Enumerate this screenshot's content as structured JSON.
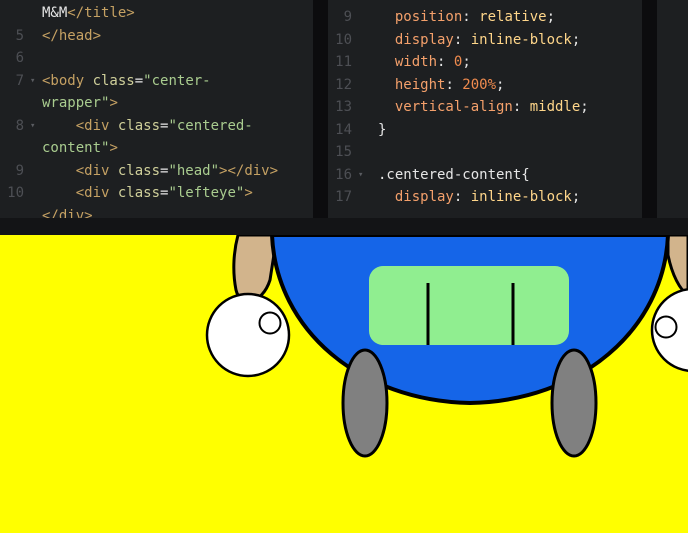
{
  "html_pane": {
    "lines": [
      {
        "num": "",
        "fold": false,
        "segments": [
          {
            "t": "M&M",
            "c": "c-text"
          },
          {
            "t": "</title>",
            "c": "c-tag"
          }
        ]
      },
      {
        "num": "5",
        "fold": false,
        "segments": [
          {
            "t": "</head>",
            "c": "c-tag"
          }
        ]
      },
      {
        "num": "6",
        "fold": false,
        "segments": []
      },
      {
        "num": "7",
        "fold": true,
        "segments": [
          {
            "t": "<body ",
            "c": "c-tag"
          },
          {
            "t": "class",
            "c": "c-attr"
          },
          {
            "t": "=",
            "c": "c-text"
          },
          {
            "t": "\"center-",
            "c": "c-str"
          }
        ]
      },
      {
        "num": "",
        "fold": false,
        "segments": [
          {
            "t": "wrapper\"",
            "c": "c-str"
          },
          {
            "t": ">",
            "c": "c-tag"
          }
        ]
      },
      {
        "num": "8",
        "fold": true,
        "segments": [
          {
            "t": "    <div ",
            "c": "c-tag"
          },
          {
            "t": "class",
            "c": "c-attr"
          },
          {
            "t": "=",
            "c": "c-text"
          },
          {
            "t": "\"centered-",
            "c": "c-str"
          }
        ]
      },
      {
        "num": "",
        "fold": false,
        "segments": [
          {
            "t": "content\"",
            "c": "c-str"
          },
          {
            "t": ">",
            "c": "c-tag"
          }
        ]
      },
      {
        "num": "9",
        "fold": false,
        "segments": [
          {
            "t": "    <div ",
            "c": "c-tag"
          },
          {
            "t": "class",
            "c": "c-attr"
          },
          {
            "t": "=",
            "c": "c-text"
          },
          {
            "t": "\"head\"",
            "c": "c-str"
          },
          {
            "t": "></div>",
            "c": "c-tag"
          }
        ]
      },
      {
        "num": "10",
        "fold": false,
        "segments": [
          {
            "t": "    <div ",
            "c": "c-tag"
          },
          {
            "t": "class",
            "c": "c-attr"
          },
          {
            "t": "=",
            "c": "c-text"
          },
          {
            "t": "\"lefteye\"",
            "c": "c-str"
          },
          {
            "t": ">",
            "c": "c-tag"
          }
        ]
      },
      {
        "num": "",
        "fold": false,
        "segments": [
          {
            "t": "</div>",
            "c": "c-tag"
          }
        ]
      }
    ]
  },
  "css_pane": {
    "lines": [
      {
        "num": "9",
        "fold": false,
        "segments": [
          {
            "t": "  position",
            "c": "c-prop"
          },
          {
            "t": ": ",
            "c": "c-text"
          },
          {
            "t": "relative",
            "c": "c-val"
          },
          {
            "t": ";",
            "c": "c-text"
          }
        ]
      },
      {
        "num": "10",
        "fold": false,
        "segments": [
          {
            "t": "  display",
            "c": "c-prop"
          },
          {
            "t": ": ",
            "c": "c-text"
          },
          {
            "t": "inline-block",
            "c": "c-val"
          },
          {
            "t": ";",
            "c": "c-text"
          }
        ]
      },
      {
        "num": "11",
        "fold": false,
        "segments": [
          {
            "t": "  width",
            "c": "c-prop"
          },
          {
            "t": ": ",
            "c": "c-text"
          },
          {
            "t": "0",
            "c": "c-num"
          },
          {
            "t": ";",
            "c": "c-text"
          }
        ]
      },
      {
        "num": "12",
        "fold": false,
        "segments": [
          {
            "t": "  height",
            "c": "c-prop"
          },
          {
            "t": ": ",
            "c": "c-text"
          },
          {
            "t": "200%",
            "c": "c-num"
          },
          {
            "t": ";",
            "c": "c-text"
          }
        ]
      },
      {
        "num": "13",
        "fold": false,
        "segments": [
          {
            "t": "  vertical-align",
            "c": "c-prop"
          },
          {
            "t": ": ",
            "c": "c-text"
          },
          {
            "t": "middle",
            "c": "c-val"
          },
          {
            "t": ";",
            "c": "c-text"
          }
        ]
      },
      {
        "num": "14",
        "fold": false,
        "segments": [
          {
            "t": "}",
            "c": "c-text"
          }
        ]
      },
      {
        "num": "15",
        "fold": false,
        "segments": []
      },
      {
        "num": "16",
        "fold": true,
        "segments": [
          {
            "t": ".centered-content{",
            "c": "c-sel"
          }
        ]
      },
      {
        "num": "17",
        "fold": false,
        "segments": [
          {
            "t": "  display",
            "c": "c-prop"
          },
          {
            "t": ": ",
            "c": "c-text"
          },
          {
            "t": "inline-block",
            "c": "c-val"
          },
          {
            "t": ";",
            "c": "c-text"
          }
        ]
      }
    ]
  },
  "preview": {
    "background": "#ffff00",
    "body_color": "#1565e8",
    "visor_color": "#90ee90",
    "foot_color": "#808080",
    "arm_color": "#d2b48c",
    "eye_color": "#ffffff"
  }
}
